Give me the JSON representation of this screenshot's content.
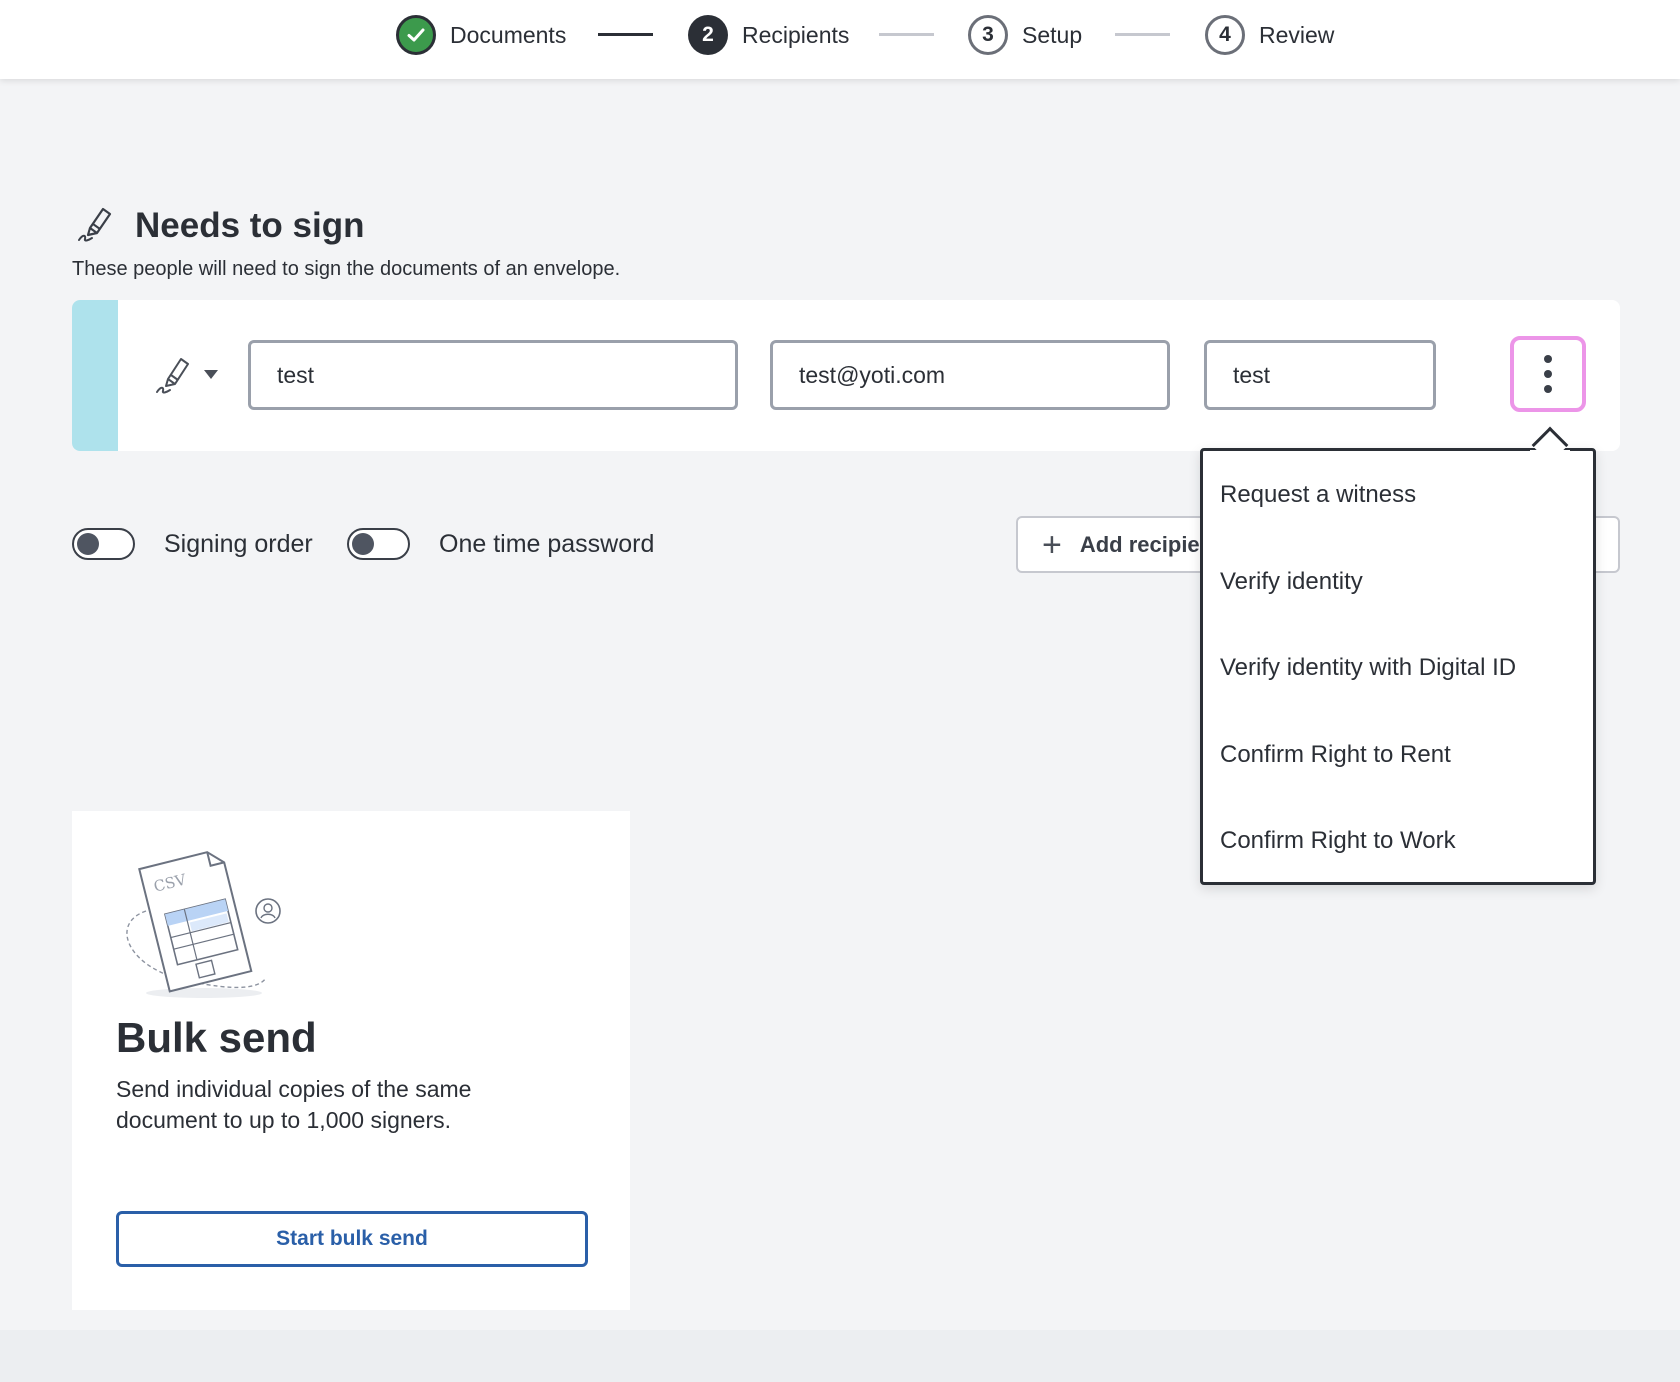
{
  "stepper": {
    "steps": [
      {
        "number": "",
        "label": "Documents",
        "state": "done"
      },
      {
        "number": "2",
        "label": "Recipients",
        "state": "active"
      },
      {
        "number": "3",
        "label": "Setup",
        "state": "todo"
      },
      {
        "number": "4",
        "label": "Review",
        "state": "todo"
      }
    ]
  },
  "section": {
    "icon": "signature-pen-icon",
    "title": "Needs to sign",
    "description": "These people will need to sign the documents of an envelope."
  },
  "recipient": {
    "role_icon": "signature-pen-icon",
    "name_value": "test",
    "email_value": "test@yoti.com",
    "third_value": "test"
  },
  "options": {
    "signing_order_label": "Signing order",
    "otp_label": "One time password",
    "add_recipient_label": "Add recipient"
  },
  "menu": {
    "items": [
      {
        "label": "Request a witness"
      },
      {
        "label": "Verify identity"
      },
      {
        "label": "Verify identity with Digital ID"
      },
      {
        "label": "Confirm Right to Rent"
      },
      {
        "label": "Confirm Right to Work"
      }
    ]
  },
  "bulk": {
    "illustration": "csv-upload-illustration",
    "illustration_text": "CSV",
    "title": "Bulk send",
    "description": "Send individual copies of the same document to up to 1,000 signers.",
    "button_label": "Start bulk send"
  },
  "colors": {
    "done_green": "#3c9a4c",
    "stripe": "#aee2ec",
    "focus_ring": "#ec95e8",
    "link_blue": "#2a5fa8"
  }
}
